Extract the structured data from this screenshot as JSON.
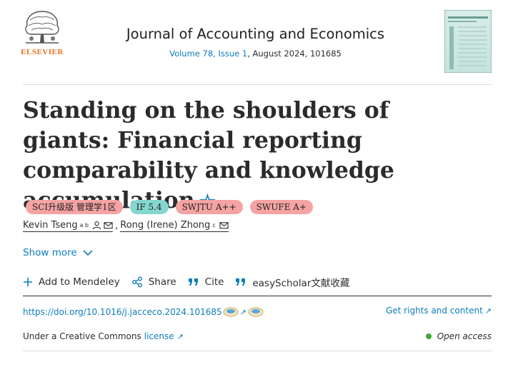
{
  "header": {
    "publisher": "ELSEVIER",
    "journal_title": "Journal of Accounting and Economics",
    "volume_issue": "Volume 78, Issue 1",
    "date_id": ", August 2024, 101685"
  },
  "article": {
    "title": "Standing on the shoulders of giants: Financial reporting comparability and knowledge accumulation",
    "star_icon": "star-outline-icon"
  },
  "badges": [
    {
      "label": "SCI升级版 管理学1区",
      "color": "#f5a3a3"
    },
    {
      "label": "IF 5.4",
      "color": "#86d6d0"
    },
    {
      "label": "SWJTU A++",
      "color": "#f5a3a3"
    },
    {
      "label": "SWUFE A+",
      "color": "#f5a3a3"
    }
  ],
  "authors": [
    {
      "name": "Kevin Tseng",
      "affil": "a b"
    },
    {
      "name": "Rong (Irene) Zhong",
      "affil": "c"
    }
  ],
  "author_separator": ",",
  "show_more": "Show more",
  "actions": {
    "mendeley": "Add to Mendeley",
    "share": "Share",
    "cite": "Cite",
    "easyscholar": "easyScholar文献收藏"
  },
  "doi": "https://doi.org/10.1016/j.jacceco.2024.101685",
  "rights_link": "Get rights and content",
  "license": {
    "prefix": "Under a Creative Commons",
    "link": "license"
  },
  "open_access": "Open access",
  "colors": {
    "link": "#0c7dbb",
    "elsevier_orange": "#e9711c",
    "open_access_dot": "#3aaa35"
  }
}
